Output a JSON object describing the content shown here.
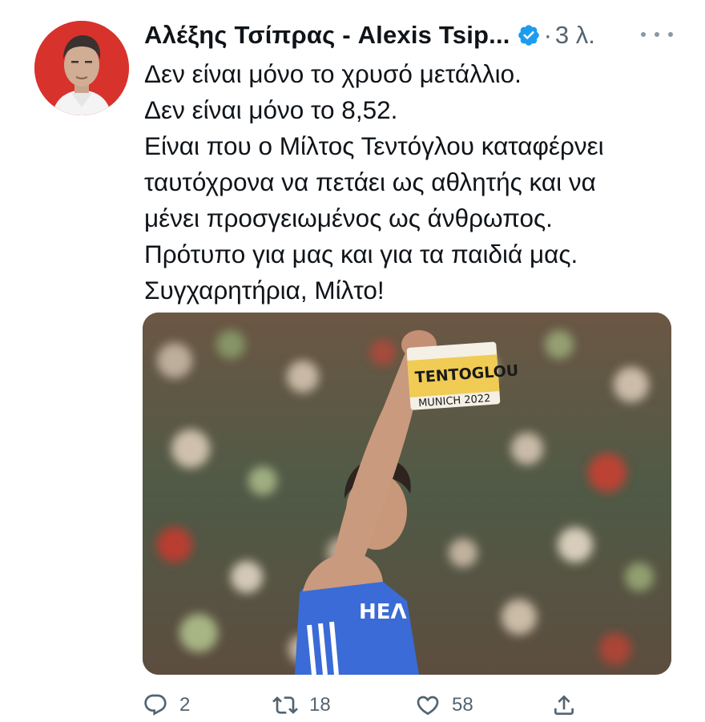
{
  "tweet": {
    "author_name": "Αλέξης Τσίπρας - Alexis Tsip...",
    "time": "3 λ.",
    "separator": "·",
    "lines": [
      "Δεν είναι μόνο το χρυσό μετάλλιο.",
      "Δεν είναι μόνο το 8,52.",
      "Είναι που ο Μίλτος Τεντόγλου καταφέρνει",
      "ταυτόχρονα να πετάει ως αθλητής και να",
      "μένει προσγειωμένος ως άνθρωπος.",
      "Πρότυπο για μας και για τα παιδιά μας.",
      "Συγχαρητήρια, Μίλτο!"
    ],
    "photo": {
      "bib_name": "TENTOGLOU",
      "bib_sub": "MUNICH 2022",
      "vest_text": "ΗΕΛ"
    }
  },
  "actions": {
    "replies": "2",
    "retweets": "18",
    "likes": "58"
  },
  "colors": {
    "verified": "#1d9bf0",
    "text": "#0f1419",
    "muted": "#536471",
    "avatar_bg": "#d8322c",
    "vest": "#3a6bd6"
  },
  "icons": [
    "verified-badge-icon",
    "more-icon",
    "reply-icon",
    "retweet-icon",
    "like-icon",
    "share-icon"
  ]
}
